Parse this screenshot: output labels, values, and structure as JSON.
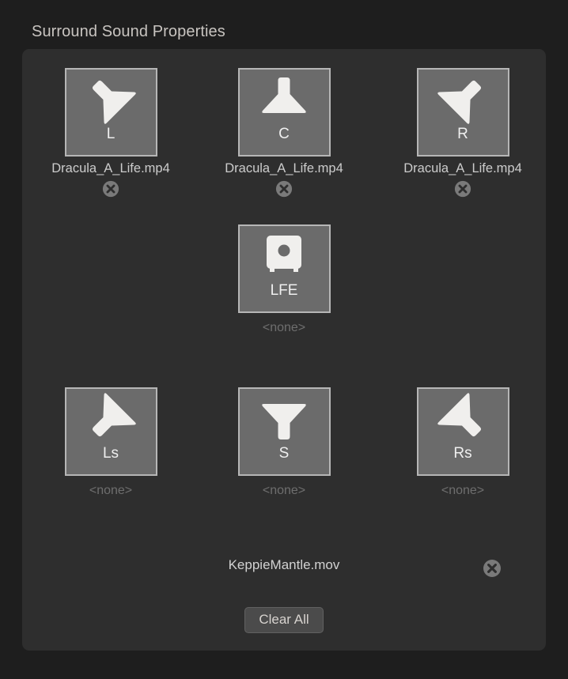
{
  "header": {
    "title": "Surround Sound Properties"
  },
  "labels": {
    "none": "<none>",
    "remove_icon": "close-circle-icon"
  },
  "speakers": [
    {
      "id": "L",
      "label": "L",
      "icon": "speaker-cone-down-right-icon",
      "assigned": "Dracula_A_Life.mp4",
      "has_file": true,
      "row": 0,
      "col": 0
    },
    {
      "id": "C",
      "label": "C",
      "icon": "speaker-cone-down-icon",
      "assigned": "Dracula_A_Life.mp4",
      "has_file": true,
      "row": 0,
      "col": 1
    },
    {
      "id": "R",
      "label": "R",
      "icon": "speaker-cone-down-left-icon",
      "assigned": "Dracula_A_Life.mp4",
      "has_file": true,
      "row": 0,
      "col": 2
    },
    {
      "id": "LFE",
      "label": "LFE",
      "icon": "subwoofer-icon",
      "assigned": "<none>",
      "has_file": false,
      "row": 1,
      "col": 1
    },
    {
      "id": "Ls",
      "label": "Ls",
      "icon": "speaker-cone-up-right-icon",
      "assigned": "<none>",
      "has_file": false,
      "row": 2,
      "col": 0
    },
    {
      "id": "S",
      "label": "S",
      "icon": "speaker-cone-up-icon",
      "assigned": "<none>",
      "has_file": false,
      "row": 2,
      "col": 1
    },
    {
      "id": "Rs",
      "label": "Rs",
      "icon": "speaker-cone-up-left-icon",
      "assigned": "<none>",
      "has_file": false,
      "row": 2,
      "col": 2
    }
  ],
  "footer": {
    "file": "KeppieMantle.mov",
    "remove_label": "remove-file",
    "clear_all_label": "Clear All"
  },
  "colors": {
    "window_background": "#1e1e1e",
    "panel_background": "#2e2e2e",
    "tile_fill": "#6b6b6b",
    "tile_border": "#b6b6b6",
    "icon_fill": "#f0efed",
    "title_text": "#c8c4c0",
    "assigned_text": "#cccccc",
    "none_text": "#6e6e6e",
    "button_fill": "#4b4b4b",
    "xbtn_fill": "#7a7a7a"
  }
}
